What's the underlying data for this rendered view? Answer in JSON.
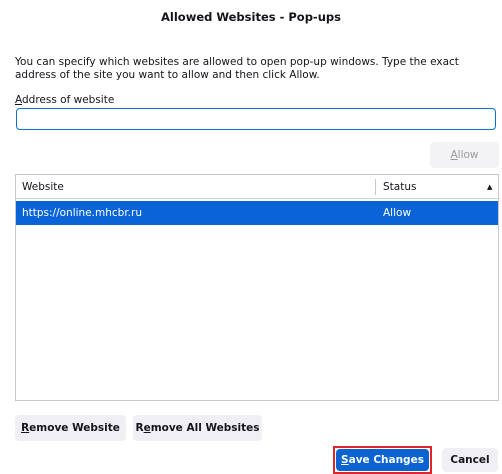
{
  "dialog": {
    "title": "Allowed Websites - Pop-ups",
    "description": "You can specify which websites are allowed to open pop-up windows. Type the exact address of the site you want to allow and then click Allow.",
    "address_label_first": "A",
    "address_label_rest": "ddress of website",
    "address_value": "",
    "allow_button_first": "A",
    "allow_button_rest": "llow"
  },
  "table": {
    "headers": {
      "website": "Website",
      "status": "Status"
    },
    "sort_direction": "ascending",
    "rows": [
      {
        "website": "https://online.mhcbr.ru",
        "status": "Allow",
        "selected": true
      }
    ]
  },
  "buttons": {
    "remove_first": "R",
    "remove_rest": "emove Website",
    "remove_all_pre": "R",
    "remove_all_ul": "e",
    "remove_all_post": "move All Websites",
    "save_first": "S",
    "save_rest": "ave Changes",
    "cancel": "Cancel"
  },
  "colors": {
    "accent": "#0a64d8",
    "highlight": "#e0242b"
  }
}
